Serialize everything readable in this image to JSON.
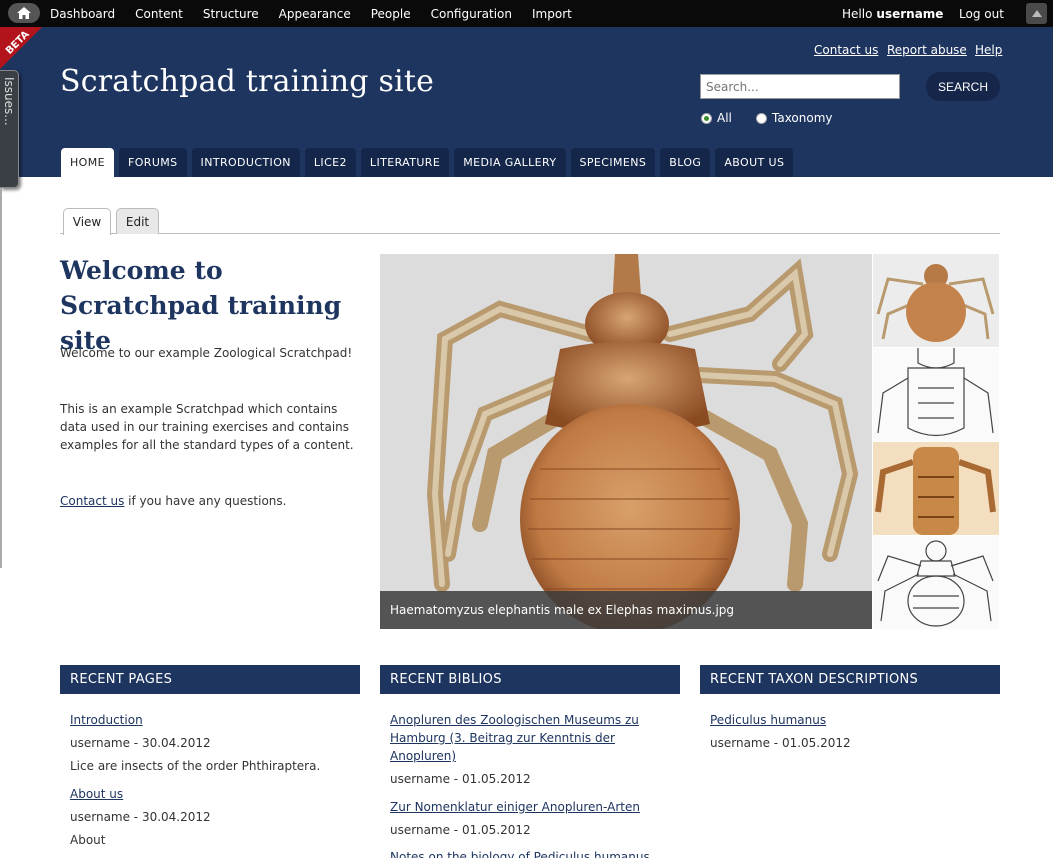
{
  "toolbar": {
    "menu": [
      "Dashboard",
      "Content",
      "Structure",
      "Appearance",
      "People",
      "Configuration",
      "Import"
    ],
    "hello": "Hello",
    "username": "username",
    "logout": "Log out"
  },
  "ribbon": {
    "label": "BETA"
  },
  "issues_tab": {
    "label": "Issues..."
  },
  "header": {
    "links": [
      "Contact us",
      "Report abuse",
      "Help"
    ],
    "site_title": "Scratchpad training site",
    "search": {
      "placeholder": "Search...",
      "button": "SEARCH"
    },
    "radios": [
      {
        "label": "All",
        "selected": true
      },
      {
        "label": "Taxonomy",
        "selected": false
      }
    ]
  },
  "primary_nav": [
    "HOME",
    "FORUMS",
    "INTRODUCTION",
    "LICE2",
    "LITERATURE",
    "MEDIA GALLERY",
    "SPECIMENS",
    "BLOG",
    "ABOUT US"
  ],
  "local_tabs": [
    "View",
    "Edit"
  ],
  "welcome": {
    "title": "Welcome to Scratchpad training site",
    "p1": "Welcome to our example Zoological Scratchpad!",
    "p2": "This is an example Scratchpad which contains data used in our training exercises and contains examples for all the standard types of a content.",
    "contact_link": "Contact us",
    "contact_rest": " if you have any questions."
  },
  "gallery": {
    "caption": "Haematomyzus elephantis male ex Elephas maximus.jpg"
  },
  "blocks": {
    "recent_pages": {
      "title": "RECENT PAGES",
      "items": [
        {
          "title": "Introduction",
          "meta": "username - 30.04.2012",
          "summary": "Lice are insects of the order Phthiraptera."
        },
        {
          "title": "About us",
          "meta": "username - 30.04.2012",
          "summary": "About"
        }
      ]
    },
    "recent_biblios": {
      "title": "RECENT BIBLIOS",
      "items": [
        {
          "title": "Anopluren des Zoologischen Museums zu Hamburg (3. Beitrag zur Kenntnis der Anopluren)",
          "meta": "username - 01.05.2012"
        },
        {
          "title": "Zur Nomenklatur einiger Anopluren-Arten",
          "meta": "username - 01.05.2012"
        },
        {
          "title": "Notes on the biology of Pediculus humanus"
        }
      ]
    },
    "recent_taxon": {
      "title": "RECENT TAXON DESCRIPTIONS",
      "items": [
        {
          "title": "Pediculus humanus",
          "meta": "username - 01.05.2012"
        }
      ]
    }
  }
}
